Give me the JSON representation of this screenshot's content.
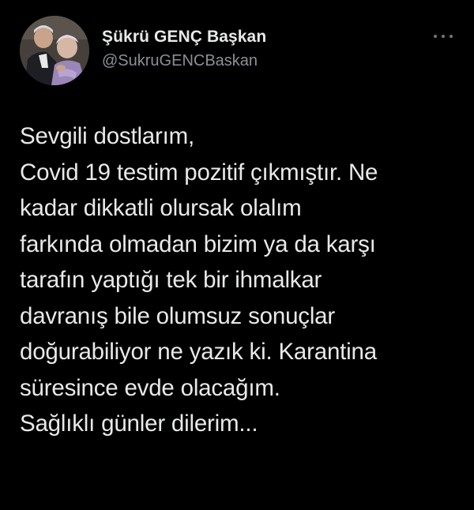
{
  "author": {
    "display_name": "Şükrü GENÇ Başkan",
    "handle": "@SukruGENCBaskan",
    "avatar_icon": "profile-photo-icon"
  },
  "menu_icon": "more-options-icon",
  "tweet": {
    "lines": [
      "Sevgili dostlarım,",
      "Covid 19 testim pozitif çıkmıştır. Ne",
      "kadar dikkatli olursak olalım",
      "farkında olmadan bizim ya da karşı",
      "tarafın yaptığı tek bir ihmalkar",
      "davranış bile olumsuz sonuçlar",
      "doğurabiliyor ne yazık ki. Karantina",
      "süresince evde olacağım.",
      "Sağlıklı günler dilerim..."
    ]
  },
  "colors": {
    "background": "#000000",
    "primary_text": "#e7e9ea",
    "secondary_text": "#8b9096"
  }
}
